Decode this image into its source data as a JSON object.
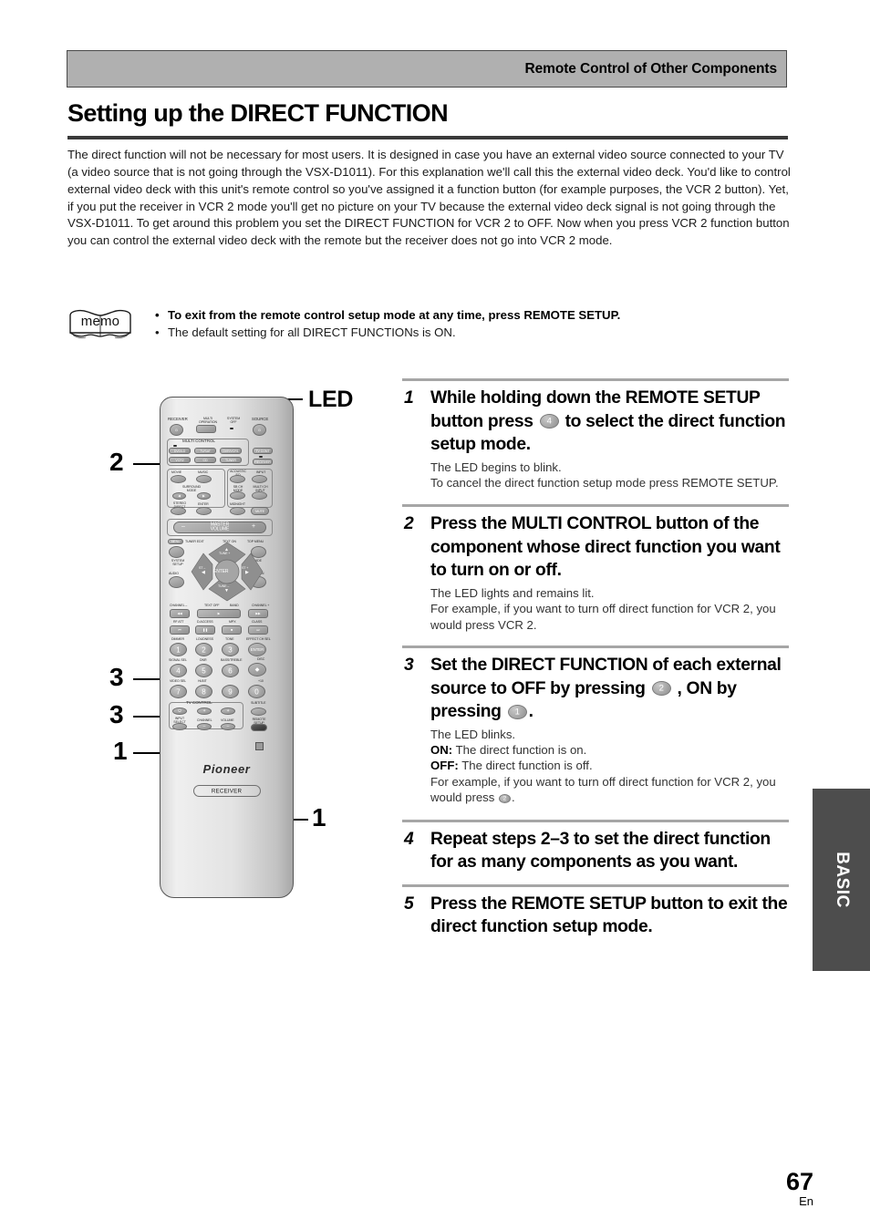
{
  "running_head": {
    "title": "Remote Control of Other Components"
  },
  "page_title": "Setting up the DIRECT FUNCTION",
  "intro": "The direct function will not be necessary for most users. It is designed in case you have an external video source connected to your TV (a video source that is not going through the VSX-D1011). For this explanation we'll call this the external video deck. You'd like to control external video deck with this unit's remote control so you've assigned it a function button (for example purposes, the VCR 2 button). Yet, if you put the receiver in VCR 2 mode you'll get no picture on your TV because the external video deck signal is not going through the VSX-D1011. To get around this problem you set the DIRECT FUNCTION for VCR 2 to OFF. Now when you press VCR 2 function button you can control the external video deck with the remote but the receiver does not go into VCR 2 mode.",
  "memo": {
    "icon_label": "memo",
    "bullet": "•",
    "items": [
      "To exit from the remote control setup mode at any time, press REMOTE SETUP.",
      "The default setting for all DIRECT FUNCTIONs is ON."
    ]
  },
  "figure": {
    "led_label": "LED",
    "callouts": [
      {
        "number": "2",
        "target": "multi-control-section"
      },
      {
        "number": "3",
        "target": "key-2"
      },
      {
        "number": "3",
        "target": "key-1"
      },
      {
        "number": "1",
        "target": "key-4"
      },
      {
        "number": "1",
        "target": "remote-setup-button"
      }
    ],
    "remote": {
      "brand": "Pioneer",
      "bottom_badge": "RECEIVER",
      "top_labels": {
        "receiver": "RECEIVER",
        "multi_operation": "MULTI\nOPERATION",
        "system_off": "SYSTEM\nOFF",
        "source": "SOURCE"
      },
      "multi_control": {
        "title": "MULTI CONTROL",
        "buttons": [
          "DVD/LD",
          "TV/SAT",
          "DVR/VCR1",
          "VCR2",
          "CD",
          "TUNER"
        ]
      },
      "side_buttons": [
        "TV CONT",
        "RECEIVER"
      ],
      "mode_buttons": [
        "MOVIE",
        "MUSIC",
        "ACOUSTIC EQ",
        "INPUT"
      ],
      "mode_labels": [
        "SURROUND MODE",
        "SB CH MODE",
        "MULTI CH INPUT",
        "STEREO/DIRECT",
        "ENTER",
        "MIDNIGHT",
        "MUTE"
      ],
      "master_volume": "MASTER VOLUME",
      "nav_labels": [
        "MENU",
        "TUNER EDIT",
        "TEXT ON",
        "TOP MENU",
        "SYSTEM SETUP",
        "GUIDE",
        "AUDIO",
        "RETURN",
        "ENTER",
        "TUNE +",
        "TUNE –",
        "ST –",
        "ST +"
      ],
      "transport_labels": [
        "CHANNEL –",
        "TEXT OFF",
        "BAND",
        "CHANNEL +",
        "RF ATT",
        "D.ACCESS",
        "MPX",
        "CLASS"
      ],
      "keypad_labels": [
        "DIMMER",
        "LOUDNESS",
        "TONE",
        "EFFECT CH SEL",
        "SIGNAL SEL",
        "DNR",
        "BASS/TREBLE",
        "DISC",
        "VIDEO SEL",
        "Hi-BIT",
        "+10"
      ],
      "keypad": [
        "1",
        "2",
        "3",
        "4",
        "5",
        "6",
        "7",
        "8",
        "9",
        "0"
      ],
      "keypad_enter": "ENTER",
      "tv_control": {
        "title": "TV CONTROL",
        "labels": [
          "INPUT SELECT",
          "CHANNEL",
          "VOLUME"
        ]
      },
      "subtitle_label": "SUBTITLE",
      "remote_setup_label": "REMOTE SETUP"
    }
  },
  "steps": [
    {
      "number": "1",
      "head_before": "While holding down the REMOTE SETUP button press ",
      "badge": "4",
      "head_after": " to select the direct function setup mode.",
      "body": "The LED begins to blink.\nTo cancel the direct function setup mode press REMOTE SETUP."
    },
    {
      "number": "2",
      "head": "Press the MULTI CONTROL button of the component whose direct function you want to turn on or off.",
      "body": "The LED lights and remains lit.\nFor example, if you want to turn off direct function for VCR 2, you would press VCR 2."
    },
    {
      "number": "3",
      "head_before": "Set the DIRECT FUNCTION of each external source to OFF by pressing ",
      "badge_off": "2",
      "head_middle": " , ON by pressing ",
      "badge_on": "1",
      "head_after": ".",
      "body_line1": "The LED blinks.",
      "on_label": "ON:",
      "on_text": " The direct function is on.",
      "off_label": "OFF:",
      "off_text": " The direct function is off.",
      "body_example_before": "For example, if you want to turn off direct function for VCR 2, you would press ",
      "body_badge": "2",
      "body_example_after": "."
    },
    {
      "number": "4",
      "head": "Repeat steps 2–3 to set the direct function for as many components as you want."
    },
    {
      "number": "5",
      "head": "Press the REMOTE SETUP button to exit the direct function setup mode."
    }
  ],
  "side_tab": {
    "label": "BASIC"
  },
  "folio": {
    "page": "67",
    "language": "En"
  },
  "colors": {
    "running_head_bg": "#b0b0b0",
    "rule": "#a6a6a6",
    "side_tab_bg": "#4d4d4d",
    "title_rule": "#3a3a3a"
  }
}
